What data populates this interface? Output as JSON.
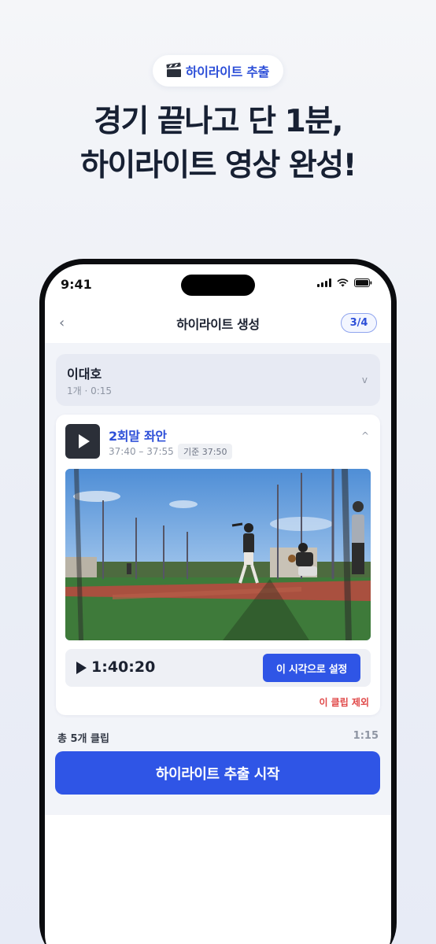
{
  "promo": {
    "badge_label": "하이라이트 추출",
    "badge_icon": "clapperboard-icon",
    "headline_line1": "경기 끝나고 단 1분,",
    "headline_line2": "하이라이트 영상 완성!"
  },
  "status_bar": {
    "time": "9:41"
  },
  "header": {
    "back_icon": "‹",
    "title": "하이라이트 생성",
    "step": "3/4"
  },
  "player": {
    "name": "이대호",
    "meta": "1개 · 0:15",
    "chevron": "v"
  },
  "clip": {
    "title": "2회말 좌안",
    "range": "37:40 – 37:55",
    "reference": "기준 37:50",
    "collapse_icon": "^",
    "current_time": "1:40:20",
    "set_button": "이 시각으로 설정",
    "exclude_link": "이 클립 제외"
  },
  "summary": {
    "total_label": "총 5개 클립",
    "total_time": "1:15"
  },
  "primary_action": {
    "label": "하이라이트 추출 시작"
  },
  "colors": {
    "accent": "#2f55e6",
    "danger": "#e04848",
    "headline": "#172033"
  }
}
